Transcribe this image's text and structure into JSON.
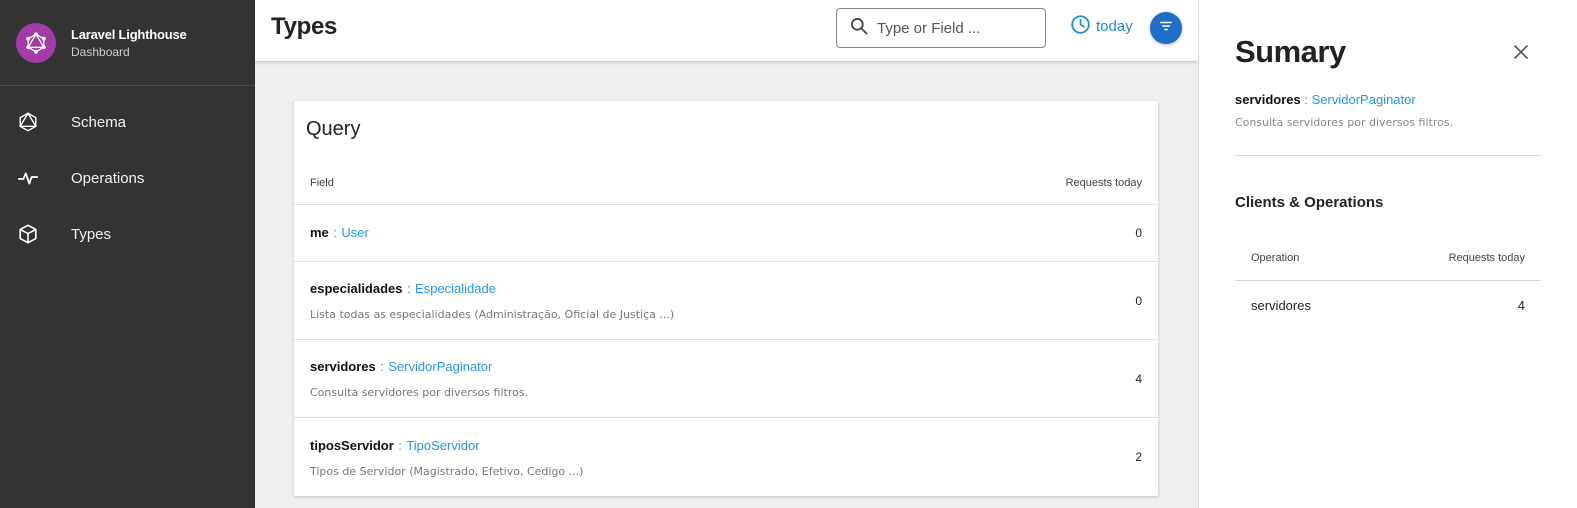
{
  "sidebar": {
    "app_name": "Laravel Lighthouse",
    "app_sub": "Dashboard",
    "items": [
      {
        "label": "Schema",
        "icon": "graphql-icon"
      },
      {
        "label": "Operations",
        "icon": "pulse-icon"
      },
      {
        "label": "Types",
        "icon": "cube-icon"
      }
    ]
  },
  "header": {
    "title": "Types",
    "search_placeholder": "Type or Field ...",
    "today_label": "today"
  },
  "query_card": {
    "title": "Query",
    "col_field": "Field",
    "col_requests": "Requests today",
    "rows": [
      {
        "name": "me",
        "sep": ":",
        "type": "User",
        "desc": "",
        "count": "0"
      },
      {
        "name": "especialidades",
        "sep": ":",
        "type": "Especialidade",
        "desc": "Lista todas as especialidades (Administração, Oficial de Justiça ...)",
        "count": "0"
      },
      {
        "name": "servidores",
        "sep": ":",
        "type": "ServidorPaginator",
        "desc": "Consulta servidores por diversos filtros.",
        "count": "4"
      },
      {
        "name": "tiposServidor",
        "sep": ":",
        "type": "TipoServidor",
        "desc": "Tipos de Servidor (Magistrado, Efetivo, Cedigo ...)",
        "count": "2"
      }
    ]
  },
  "panel": {
    "title": "Sumary",
    "field_name": "servidores",
    "sep": ":",
    "field_type": "ServidorPaginator",
    "field_desc": "Consulta servidores por diversos filtros.",
    "clients_title": "Clients & Operations",
    "col_operation": "Operation",
    "col_requests": "Requests today",
    "rows": [
      {
        "operation": "servidores",
        "count": "4"
      }
    ]
  },
  "colors": {
    "sidebar_bg": "#333333",
    "brand_logo": "#a33ca8",
    "accent": "#1e88e5",
    "link": "#2196f3"
  }
}
